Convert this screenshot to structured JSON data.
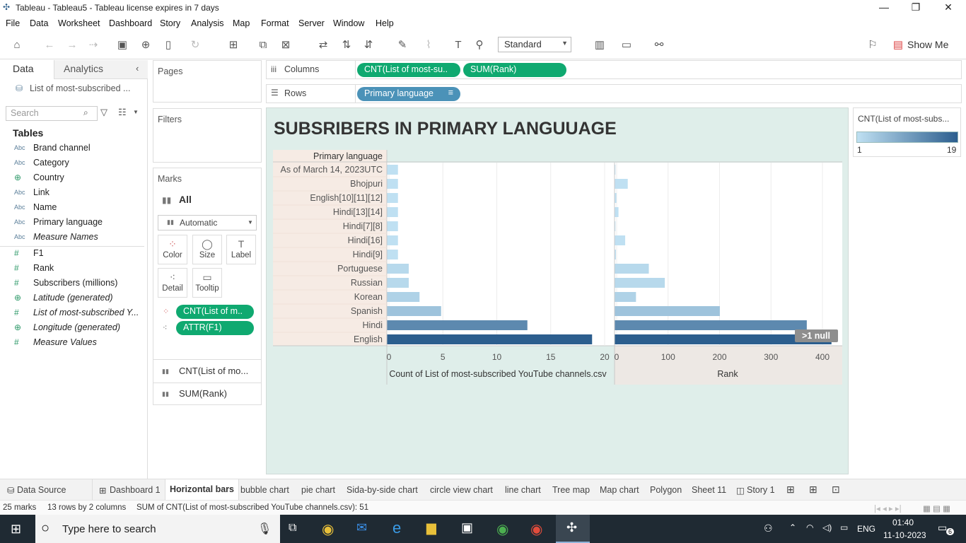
{
  "window": {
    "title": "Tableau - Tableau5 - Tableau license expires in 7 days"
  },
  "menu": [
    "File",
    "Data",
    "Worksheet",
    "Dashboard",
    "Story",
    "Analysis",
    "Map",
    "Format",
    "Server",
    "Window",
    "Help"
  ],
  "toolbar": {
    "fit_value": "Standard",
    "show_me": "Show Me"
  },
  "datapane": {
    "tab_data": "Data",
    "tab_analytics": "Analytics",
    "source": "List of most-subscribed ...",
    "search_placeholder": "Search",
    "tables_header": "Tables",
    "fields": [
      {
        "icon": "Abc",
        "label": "Brand channel",
        "italic": false
      },
      {
        "icon": "Abc",
        "label": "Category",
        "italic": false
      },
      {
        "icon": "globe",
        "label": "Country",
        "italic": false
      },
      {
        "icon": "Abc",
        "label": "Link",
        "italic": false
      },
      {
        "icon": "Abc",
        "label": "Name",
        "italic": false
      },
      {
        "icon": "Abc",
        "label": "Primary language",
        "italic": false
      },
      {
        "icon": "Abc",
        "label": "Measure Names",
        "italic": true
      },
      {
        "icon": "#",
        "label": "F1",
        "italic": false
      },
      {
        "icon": "#",
        "label": "Rank",
        "italic": false
      },
      {
        "icon": "#",
        "label": "Subscribers (millions)",
        "italic": false
      },
      {
        "icon": "globe",
        "label": "Latitude (generated)",
        "italic": true
      },
      {
        "icon": "#",
        "label": "List of most-subscribed Y...",
        "italic": true
      },
      {
        "icon": "globe",
        "label": "Longitude (generated)",
        "italic": true
      },
      {
        "icon": "#",
        "label": "Measure Values",
        "italic": true
      }
    ]
  },
  "shelves": {
    "pages": "Pages",
    "filters": "Filters",
    "columns_label": "Columns",
    "rows_label": "Rows",
    "columns": [
      "CNT(List of most-su..",
      "SUM(Rank)"
    ],
    "rows": [
      "Primary language"
    ]
  },
  "marks": {
    "title": "Marks",
    "all": "All",
    "type": "Automatic",
    "buttons": [
      "Color",
      "Size",
      "Label",
      "Detail",
      "Tooltip"
    ],
    "pills": [
      "CNT(List of m..",
      "ATTR(F1)"
    ],
    "sections": [
      "CNT(List of mo...",
      "SUM(Rank)"
    ]
  },
  "legend": {
    "title": "CNT(List of most-subs...",
    "min": "1",
    "max": "19",
    "color_low": "#bfe0f2",
    "color_high": "#2c5e8e"
  },
  "viz": {
    "title": "SUBSRIBERS IN PRIMARY LANGUUAGE",
    "null_badge": ">1 null"
  },
  "chart_data": {
    "type": "bar",
    "orientation": "horizontal",
    "row_header": "Primary language",
    "categories": [
      "As of March 14, 2023UTC",
      "Bhojpuri",
      "English[10][11][12]",
      "Hindi[13][14]",
      "Hindi[7][8]",
      "Hindi[16]",
      "Hindi[9]",
      "Portuguese",
      "Russian",
      "Korean",
      "Spanish",
      "Hindi",
      "English"
    ],
    "series": [
      {
        "name": "Count of List of most-subscribed YouTube channels.csv",
        "values": [
          1,
          1,
          1,
          1,
          1,
          1,
          1,
          2,
          2,
          3,
          5,
          13,
          19
        ],
        "xlabel": "Count of List of most-subscribed YouTube channels.csv",
        "ticks": [
          0,
          5,
          10,
          15,
          20
        ],
        "xlim": [
          0,
          20
        ]
      },
      {
        "name": "Rank",
        "values": [
          0,
          25,
          3,
          7,
          0,
          20,
          1,
          66,
          97,
          41,
          204,
          373,
          421
        ],
        "xlabel": "Rank",
        "ticks": [
          0,
          100,
          200,
          300,
          400
        ],
        "xlim": [
          0,
          440
        ]
      }
    ],
    "color_count": [
      1,
      1,
      1,
      1,
      1,
      1,
      1,
      2,
      2,
      3,
      5,
      13,
      19
    ]
  },
  "tabs": {
    "datasource": "Data Source",
    "sheets": [
      "Dashboard 1",
      "Horizontal bars",
      "bubble chart",
      "pie chart",
      "Sida-by-side chart",
      "circle view chart",
      "line chart",
      "Tree map",
      "Map chart",
      "Polygon",
      "Sheet 11",
      "Story 1"
    ],
    "active": "Horizontal bars"
  },
  "status": {
    "marks": "25 marks",
    "dims": "13 rows by 2 columns",
    "sum": "SUM of CNT(List of most-subscribed YouTube channels.csv): 51"
  },
  "taskbar": {
    "search_placeholder": "Type here to search",
    "lang": "ENG",
    "time": "01:40",
    "date": "11-10-2023",
    "notifications": "6"
  }
}
